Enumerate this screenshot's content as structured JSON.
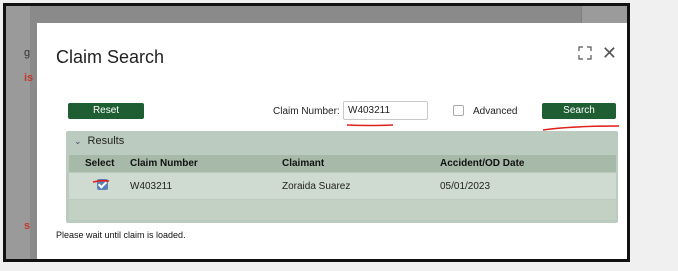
{
  "background": {
    "frag_top": "g",
    "frag_red_1": "is",
    "frag_red_2": "s"
  },
  "modal": {
    "title": "Claim Search",
    "expand_icon": "expand-icon",
    "close_icon": "close-icon",
    "close_glyph": "✕"
  },
  "toolbar": {
    "reset_label": "Reset",
    "claim_number_label": "Claim Number:",
    "claim_number_value": "W403211",
    "advanced_label": "Advanced",
    "advanced_checked": false,
    "search_label": "Search"
  },
  "results": {
    "title": "Results",
    "collapse_glyph": "⌄",
    "columns": [
      "",
      "Select",
      "Claim Number",
      "Claimant",
      "Accident/OD Date"
    ],
    "rows": [
      {
        "selected": true,
        "claim_number": "W403211",
        "claimant": "Zoraida Suarez",
        "date": "05/01/2023"
      }
    ]
  },
  "status": "Please wait until claim is loaded.",
  "colors": {
    "button_green": "#1f5e33",
    "results_bg": "#bccbbf",
    "annotation_red": "#e0201b"
  }
}
